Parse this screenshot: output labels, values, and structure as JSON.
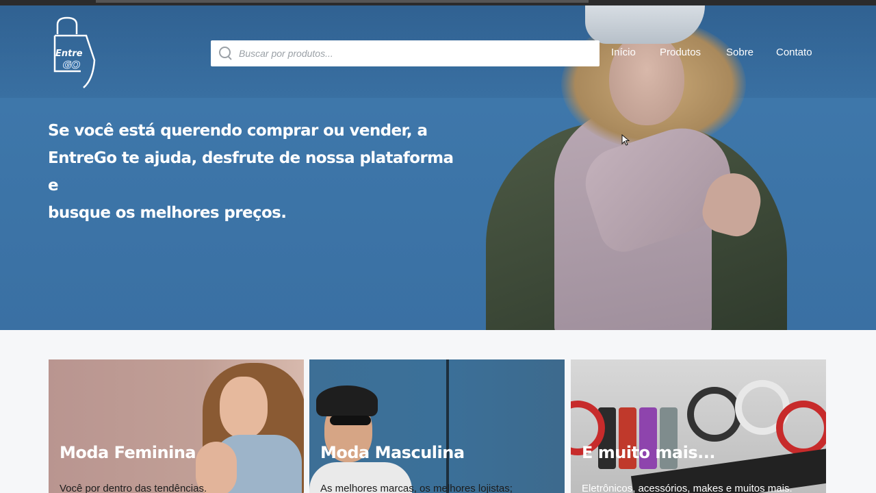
{
  "header": {
    "logo_text": "EntreGo",
    "search_placeholder": "Buscar por produtos...",
    "nav": [
      {
        "label": "Início"
      },
      {
        "label": "Produtos"
      },
      {
        "label": "Sobre"
      },
      {
        "label": "Contato"
      }
    ]
  },
  "hero": {
    "headline_lines": [
      "Se você está querendo comprar ou vender, a",
      "EntreGo te ajuda, desfrute de nossa plataforma e",
      "busque os melhores preços."
    ]
  },
  "categories": [
    {
      "title": "Moda Feminina",
      "description": "Você por dentro das tendências."
    },
    {
      "title": "Moda Masculina",
      "description": "As melhores marcas, os melhores lojistas;"
    },
    {
      "title": "E muito mais...",
      "description": "Eletrônicos, acessórios, makes e muitos mais."
    }
  ],
  "colors": {
    "hero_blue": "#3e77aa",
    "accent_white": "#ffffff"
  }
}
